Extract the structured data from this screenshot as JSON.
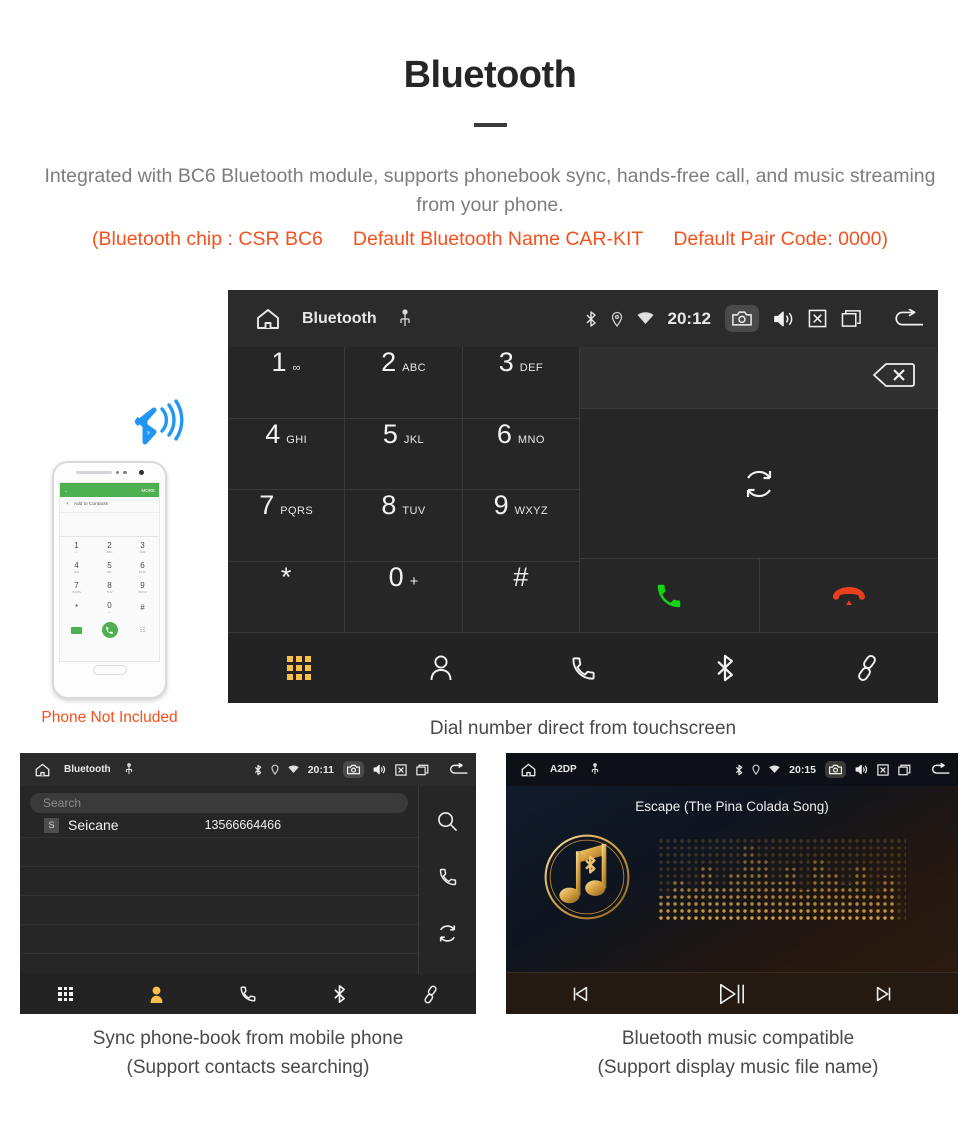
{
  "header": {
    "title": "Bluetooth",
    "lead": "Integrated with BC6 Bluetooth module, supports phonebook sync, hands-free call, and music streaming from your phone.",
    "specs": [
      "(Bluetooth chip : CSR BC6",
      "Default Bluetooth Name CAR-KIT",
      "Default Pair Code: 0000)"
    ],
    "accent_color": "#f4511e",
    "text_color": "#7d7d7d"
  },
  "dialer": {
    "statusbar": {
      "title": "Bluetooth",
      "time": "20:12",
      "icons_left": [
        "home-icon",
        "usb-icon"
      ],
      "icons_right": [
        "bluetooth-icon",
        "location-icon",
        "wifi-icon",
        "camera-icon",
        "volume-icon",
        "close-box-icon",
        "recents-icon",
        "back-icon"
      ]
    },
    "keys": [
      {
        "num": "1",
        "sub": "∞"
      },
      {
        "num": "2",
        "sub": "ABC"
      },
      {
        "num": "3",
        "sub": "DEF"
      },
      {
        "num": "4",
        "sub": "GHI"
      },
      {
        "num": "5",
        "sub": "JKL"
      },
      {
        "num": "6",
        "sub": "MNO"
      },
      {
        "num": "7",
        "sub": "PQRS"
      },
      {
        "num": "8",
        "sub": "TUV"
      },
      {
        "num": "9",
        "sub": "WXYZ"
      },
      {
        "num": "*",
        "sub": ""
      },
      {
        "num": "0",
        "sub": "+"
      },
      {
        "num": "#",
        "sub": ""
      }
    ],
    "number_display": "",
    "backspace": "backspace-icon",
    "sync": "sync-icon",
    "call": "call-icon",
    "hangup": "hangup-icon",
    "call_color": "#15d215",
    "hangup_color": "#e8401f",
    "nav": [
      {
        "name": "dialpad",
        "active": true
      },
      {
        "name": "contacts",
        "active": false
      },
      {
        "name": "call-log",
        "active": false
      },
      {
        "name": "bluetooth",
        "active": false
      },
      {
        "name": "link",
        "active": false
      }
    ],
    "active_color": "#fbbf4a"
  },
  "phone_mockup": {
    "appbar_more": "MORE",
    "add_contacts": "Add to Contacts",
    "keys": [
      {
        "num": "1",
        "sub": "∞"
      },
      {
        "num": "2",
        "sub": "ABC"
      },
      {
        "num": "3",
        "sub": "DEF"
      },
      {
        "num": "4",
        "sub": "GHI"
      },
      {
        "num": "5",
        "sub": "JKL"
      },
      {
        "num": "6",
        "sub": "MNO"
      },
      {
        "num": "7",
        "sub": "PQRS"
      },
      {
        "num": "8",
        "sub": "TUV"
      },
      {
        "num": "9",
        "sub": "WXYZ"
      },
      {
        "num": "*",
        "sub": ""
      },
      {
        "num": "0",
        "sub": "+"
      },
      {
        "num": "#",
        "sub": ""
      }
    ],
    "not_included_label": "Phone Not Included",
    "not_included_color": "#f4511e"
  },
  "phonebook": {
    "statusbar": {
      "title": "Bluetooth",
      "time": "20:11"
    },
    "search_placeholder": "Search",
    "contacts": [
      {
        "initial": "S",
        "name": "Seicane",
        "number": "13566664466"
      }
    ],
    "side_actions": [
      "search-icon",
      "call-icon",
      "sync-icon"
    ],
    "nav": [
      {
        "name": "dialpad",
        "active": false
      },
      {
        "name": "contacts",
        "active": true
      },
      {
        "name": "call-log",
        "active": false
      },
      {
        "name": "bluetooth",
        "active": false
      },
      {
        "name": "link",
        "active": false
      }
    ]
  },
  "music": {
    "statusbar": {
      "title": "A2DP",
      "time": "20:15"
    },
    "song_title": "Escape (The Pina Colada Song)",
    "controls": [
      "previous-icon",
      "play-pause-icon",
      "next-icon"
    ],
    "accent_color": "#d9a441"
  },
  "captions": {
    "dialer": "Dial number direct from touchscreen",
    "phonebook_line1": "Sync phone-book from mobile phone",
    "phonebook_line2": "(Support contacts searching)",
    "music_line1": "Bluetooth music compatible",
    "music_line2": "(Support display music file name)"
  }
}
